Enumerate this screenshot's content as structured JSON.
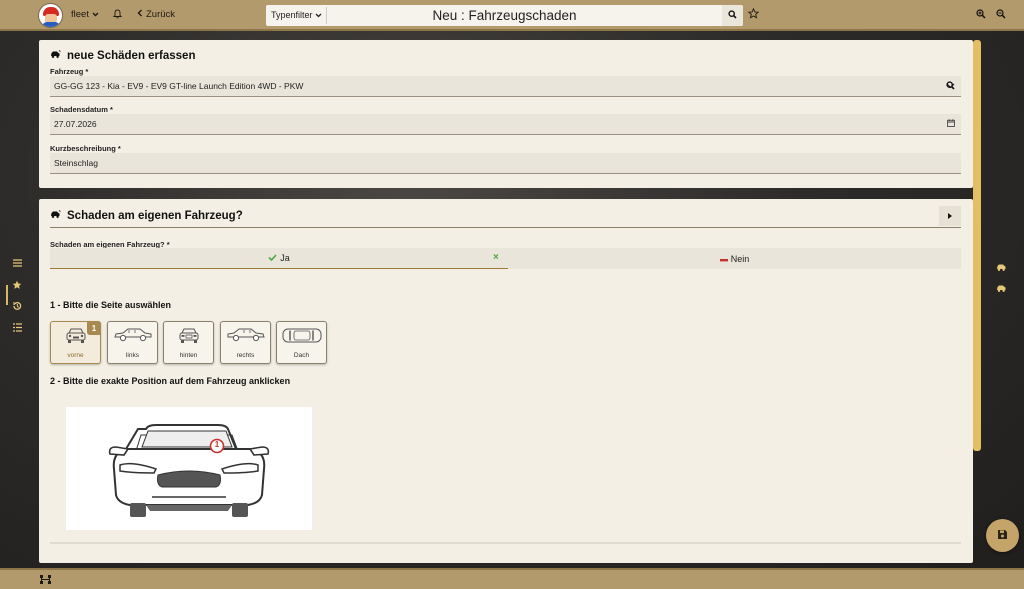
{
  "topbar": {
    "user_label": "fleet",
    "back_label": "Zurück",
    "type_filter": "Typenfilter",
    "page_title": "Neu : Fahrzeugschaden"
  },
  "form": {
    "title": "neue Schäden erfassen",
    "vehicle_label": "Fahrzeug *",
    "vehicle_value": "GG-GG 123 - Kia - EV9 - EV9 GT-line Launch Edition 4WD - PKW",
    "date_label": "Schadensdatum *",
    "date_value": "27.07.2026",
    "desc_label": "Kurzbeschreibung *",
    "desc_value": "Steinschlag"
  },
  "own_vehicle": {
    "title": "Schaden am eigenen Fahrzeug?",
    "question_label": "Schaden am eigenen Fahrzeug? *",
    "yes_label": "Ja",
    "no_label": "Nein",
    "selected": "Ja"
  },
  "steps": {
    "step1": "1 - Bitte die Seite auswählen",
    "step2": "2 - Bitte die exakte Position auf dem Fahrzeug anklicken"
  },
  "sides": [
    {
      "label": "vorne",
      "badge": "1",
      "selected": true
    },
    {
      "label": "links",
      "badge": "",
      "selected": false
    },
    {
      "label": "hinten",
      "badge": "",
      "selected": false
    },
    {
      "label": "rechts",
      "badge": "",
      "selected": false
    },
    {
      "label": "Dach",
      "badge": "",
      "selected": false
    }
  ],
  "damage_marker": "1",
  "colors": {
    "accent": "#b39a6c",
    "scroll": "#e4be63",
    "panel": "#f3efe4",
    "check": "#4caa3b",
    "minus": "#c6322e"
  }
}
